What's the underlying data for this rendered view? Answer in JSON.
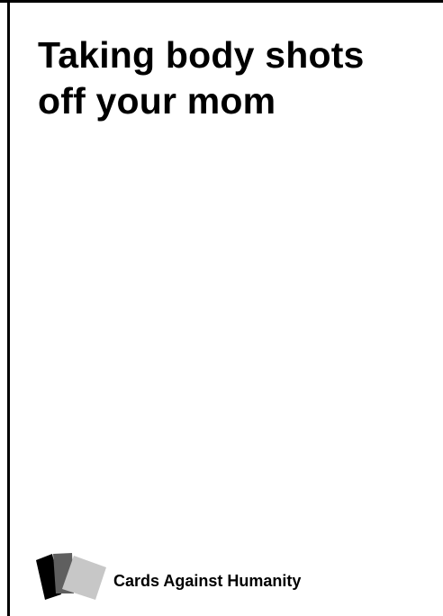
{
  "card": {
    "text_line_1": "Taking body shots",
    "text_line_2": "off your mom"
  },
  "footer": {
    "brand": "Cards Against Humanity",
    "logo_icon": "stacked-cards-icon"
  },
  "colors": {
    "background": "#ffffff",
    "text": "#000000",
    "card_black": "#000000",
    "card_gray": "#5f5f5f",
    "card_light": "#c7c7c7"
  }
}
